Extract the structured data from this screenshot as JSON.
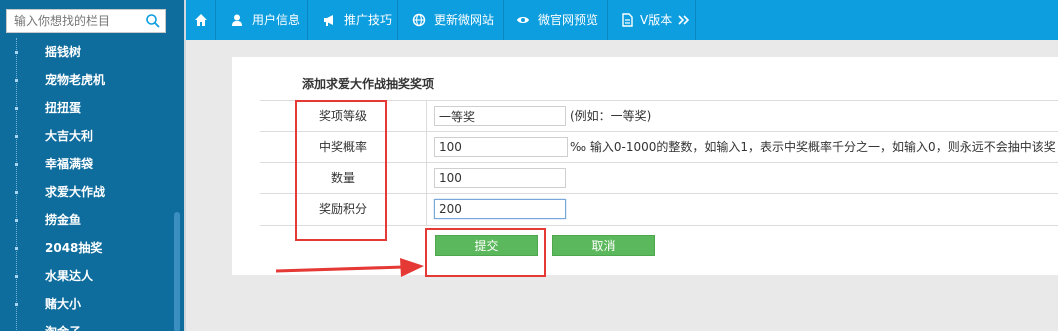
{
  "sidebar": {
    "search": {
      "placeholder": "输入你想找的栏目"
    },
    "items": [
      {
        "label": "摇钱树"
      },
      {
        "label": "宠物老虎机"
      },
      {
        "label": "扭扭蛋"
      },
      {
        "label": "大吉大利"
      },
      {
        "label": "幸福满袋"
      },
      {
        "label": "求爱大作战"
      },
      {
        "label": "捞金鱼"
      },
      {
        "label": "2048抽奖"
      },
      {
        "label": "水果达人"
      },
      {
        "label": "赌大小"
      },
      {
        "label": "淘金子"
      }
    ]
  },
  "topnav": {
    "items": [
      {
        "label": "",
        "icon": "home-icon"
      },
      {
        "label": "用户信息",
        "icon": "user-icon"
      },
      {
        "label": "推广技巧",
        "icon": "megaphone-icon"
      },
      {
        "label": "更新微网站",
        "icon": "globe-icon"
      },
      {
        "label": "微官网预览",
        "icon": "eye-icon"
      },
      {
        "label": "V版本",
        "icon": "file-icon"
      }
    ]
  },
  "form": {
    "title": "添加求爱大作战抽奖奖项",
    "fields": [
      {
        "label": "奖项等级",
        "value": "一等奖",
        "hint": "(例如：一等奖)"
      },
      {
        "label": "中奖概率",
        "value": "100",
        "hint": "‰ 输入0-1000的整数，如输入1，表示中奖概率千分之一，如输入0，则永远不会抽中该奖"
      },
      {
        "label": "数量",
        "value": "100",
        "hint": ""
      },
      {
        "label": "奖励积分",
        "value": "200",
        "hint": ""
      }
    ],
    "submit_label": "提交",
    "cancel_label": "取消"
  },
  "colors": {
    "sidebar_bg": "#0f6d9e",
    "topnav_bg": "#0d9ee0",
    "button_green": "#5cb85c",
    "annotation_red": "#e53935"
  }
}
